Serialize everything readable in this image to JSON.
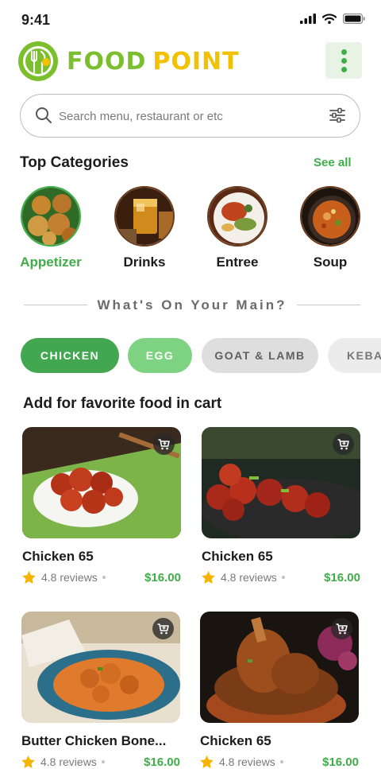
{
  "status": {
    "time": "9:41"
  },
  "brand": {
    "word1": "FOOD",
    "word2": "POINT"
  },
  "search": {
    "placeholder": "Search menu, restaurant or etc"
  },
  "categories_section": {
    "title": "Top Categories",
    "see_all": "See all"
  },
  "categories": [
    {
      "label": "Appetizer",
      "active": true
    },
    {
      "label": "Drinks",
      "active": false
    },
    {
      "label": "Entree",
      "active": false
    },
    {
      "label": "Soup",
      "active": false
    }
  ],
  "divider": {
    "text": "What's On Your Main?"
  },
  "chips": [
    {
      "label": "CHICKEN"
    },
    {
      "label": "EGG"
    },
    {
      "label": "GOAT & LAMB"
    },
    {
      "label": "KEBAB"
    }
  ],
  "food_section": {
    "title": "Add for favorite food in cart"
  },
  "foods": [
    {
      "name": "Chicken 65",
      "reviews": "4.8 reviews",
      "price": "$16.00"
    },
    {
      "name": "Chicken 65",
      "reviews": "4.8 reviews",
      "price": "$16.00"
    },
    {
      "name": "Butter Chicken Bone...",
      "reviews": "4.8 reviews",
      "price": "$16.00"
    },
    {
      "name": "Chicken 65",
      "reviews": "4.8 reviews",
      "price": "$16.00"
    }
  ],
  "colors": {
    "brand_green": "#7cbf2e",
    "brand_yellow": "#f2c200",
    "accent": "#3fae49"
  },
  "icons": {
    "search": "search-icon",
    "filter": "filter-icon",
    "menu": "more-vertical-icon",
    "cart": "cart-icon",
    "star": "star-icon"
  }
}
